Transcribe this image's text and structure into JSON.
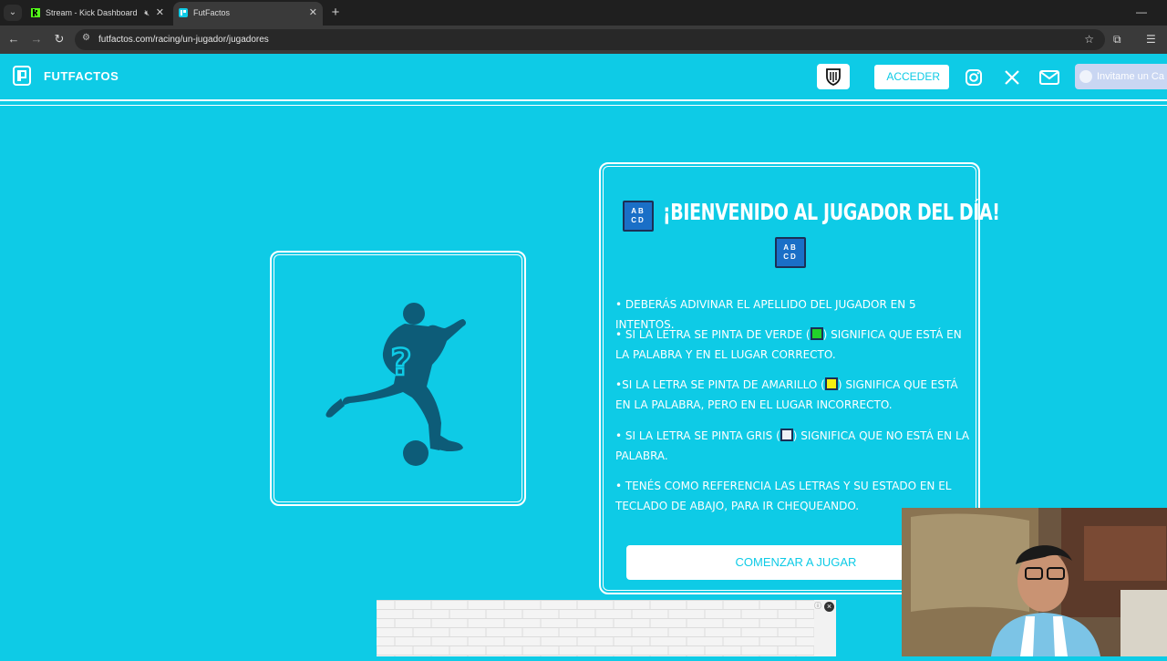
{
  "browser": {
    "tabs": [
      {
        "title": "Stream - Kick Dashboard",
        "active": false
      },
      {
        "title": "FutFactos",
        "active": true
      }
    ],
    "url": "futfactos.com/racing/un-jugador/jugadores"
  },
  "header": {
    "logo_text": "FUTFACTOS",
    "login_label": "ACCEDER",
    "invite_label": "Invitame un Ca"
  },
  "welcome": {
    "badge_text": "AB CD",
    "title": "¡BIENVENIDO AL JUGADOR DEL DÍA!",
    "rules": [
      {
        "before": "• Deberás adivinar el apellido del jugador en 5 intentos.",
        "after": ""
      },
      {
        "before": "• Si la letra se pinta de verde (",
        "swatch": "g",
        "after": ") significa que está en la palabra y en el lugar correcto."
      },
      {
        "before": "•Si la letra se pinta de amarillo (",
        "swatch": "y",
        "after": ") significa que está en la palabra, pero en el lugar incorrecto."
      },
      {
        "before": "• Si la letra se pinta gris (",
        "swatch": "w",
        "after": ") significa que no está en la palabra."
      },
      {
        "before": "• Tenés como referencia las letras y su estado en el teclado de abajo, para ir chequeando.",
        "after": ""
      }
    ],
    "start_label": "COMENZAR A JUGAR"
  },
  "colors": {
    "background": "#0ecbe6",
    "green": "#22d12a",
    "yellow": "#f5ef10",
    "grey": "#eef1f5",
    "silhouette": "#0d5c78"
  }
}
